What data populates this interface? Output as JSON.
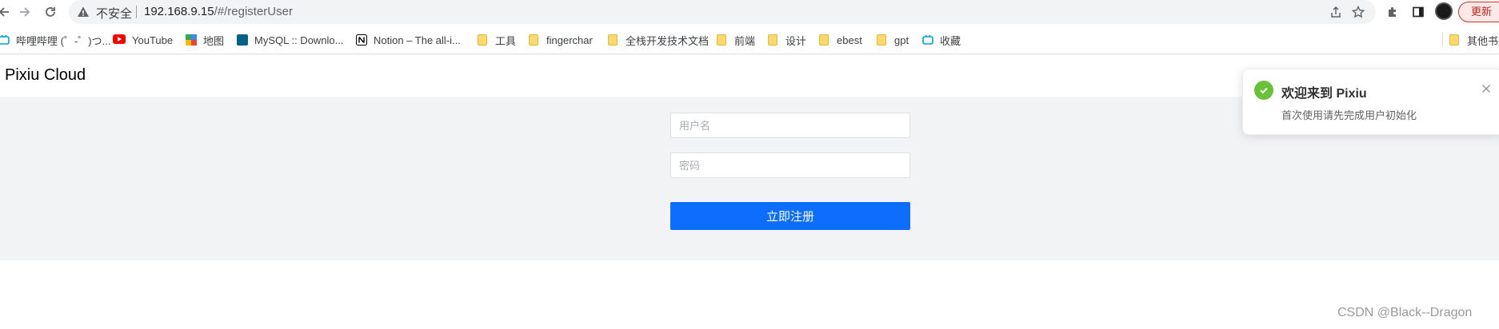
{
  "browser": {
    "security_label": "不安全",
    "url_host": "192.168.9.15",
    "url_path": "/#/registerUser",
    "update_label": "更新"
  },
  "bookmarks": [
    {
      "label": "哔哩哔哩 (゜-゜)つ...",
      "icon": "bilibili-icon"
    },
    {
      "label": "YouTube",
      "icon": "youtube-icon"
    },
    {
      "label": "地图",
      "icon": "maps-icon"
    },
    {
      "label": "MySQL :: Downlo...",
      "icon": "mysql-icon"
    },
    {
      "label": "Notion – The all-i...",
      "icon": "notion-icon"
    },
    {
      "label": "工具",
      "icon": "folder-icon"
    },
    {
      "label": "fingerchar",
      "icon": "folder-icon"
    },
    {
      "label": "全栈开发技术文档",
      "icon": "folder-icon"
    },
    {
      "label": "前端",
      "icon": "folder-icon"
    },
    {
      "label": "设计",
      "icon": "folder-icon"
    },
    {
      "label": "ebest",
      "icon": "folder-icon"
    },
    {
      "label": "gpt",
      "icon": "folder-icon"
    },
    {
      "label": "收藏",
      "icon": "bilibili-icon"
    }
  ],
  "other_bookmarks": "其他书签",
  "page": {
    "brand": "Pixiu Cloud",
    "username_placeholder": "用户名",
    "password_placeholder": "密码",
    "register_label": "立即注册"
  },
  "notification": {
    "title": "欢迎来到 Pixiu",
    "message": "首次使用请先完成用户初始化"
  },
  "watermark": "CSDN @Black--Dragon",
  "colors": {
    "primary_button": "#0d6efd",
    "success": "#67c23a",
    "content_bg": "#f2f3f5"
  }
}
